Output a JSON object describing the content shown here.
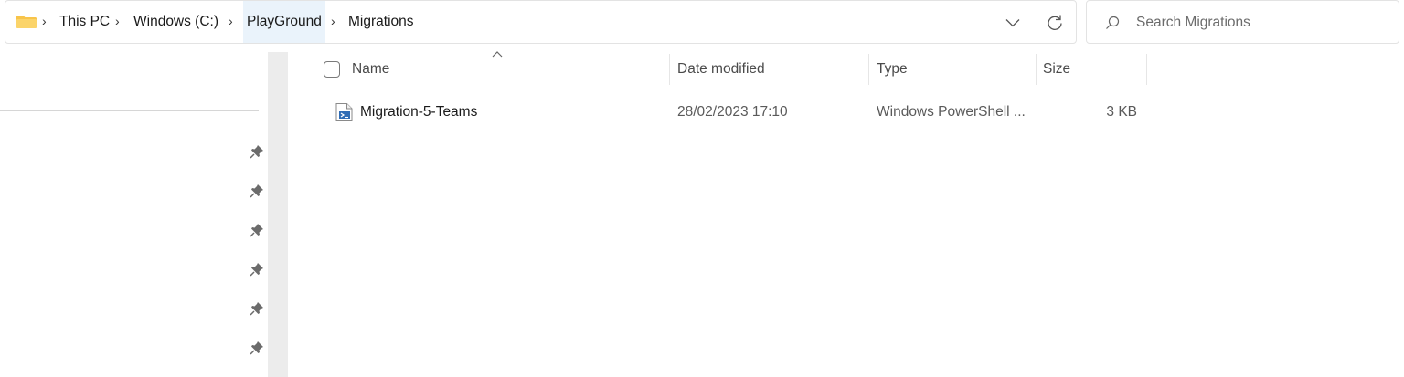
{
  "address_bar": {
    "folder_icon": "folder-icon",
    "crumbs": [
      "This PC",
      "Windows (C:)",
      "PlayGround",
      "Migrations"
    ],
    "separator": "›",
    "dropdown_icon": "chevron-down-icon",
    "refresh_icon": "refresh-icon"
  },
  "search": {
    "placeholder": "Search Migrations",
    "icon": "search-icon"
  },
  "nav_pane": {
    "pin_icon": "pin-icon",
    "pinned_count": 6
  },
  "columns": {
    "name": "Name",
    "date": "Date modified",
    "type": "Type",
    "size": "Size"
  },
  "files": [
    {
      "name": "Migration-5-Teams",
      "date": "28/02/2023 17:10",
      "type": "Windows PowerShell ...",
      "size": "3 KB",
      "icon": "powershell-script-icon"
    }
  ],
  "colors": {
    "folder": "#f8c44a",
    "highlight": "#eaf3fb",
    "border": "#e3e3e3"
  }
}
